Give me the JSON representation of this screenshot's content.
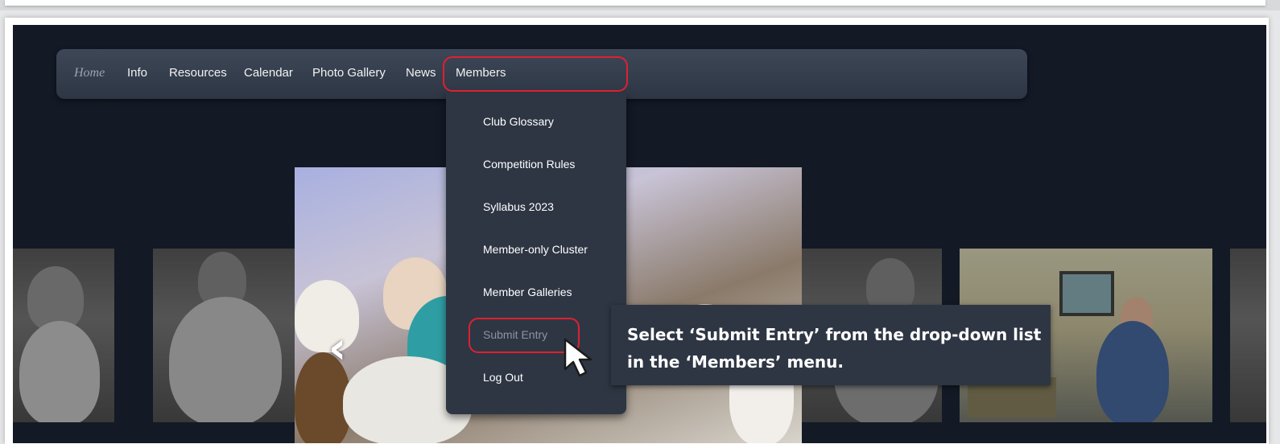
{
  "nav": {
    "home": "Home",
    "info": "Info",
    "resources": "Resources",
    "calendar": "Calendar",
    "photo_gallery": "Photo Gallery",
    "news": "News",
    "members": "Members"
  },
  "members_menu": {
    "items": [
      "Club Glossary",
      "Competition Rules",
      "Syllabus 2023",
      "Member-only Cluster",
      "Member Galleries",
      "Submit Entry",
      "Log Out"
    ]
  },
  "callout": {
    "text": "Select ‘Submit Entry’ from the drop-down list in the ‘Members’ menu."
  },
  "slideshow": {
    "prev_icon": "chevron-left-icon"
  },
  "colors": {
    "highlight": "#e02030",
    "navbar": "#2e3644",
    "page_background": "#131925"
  }
}
